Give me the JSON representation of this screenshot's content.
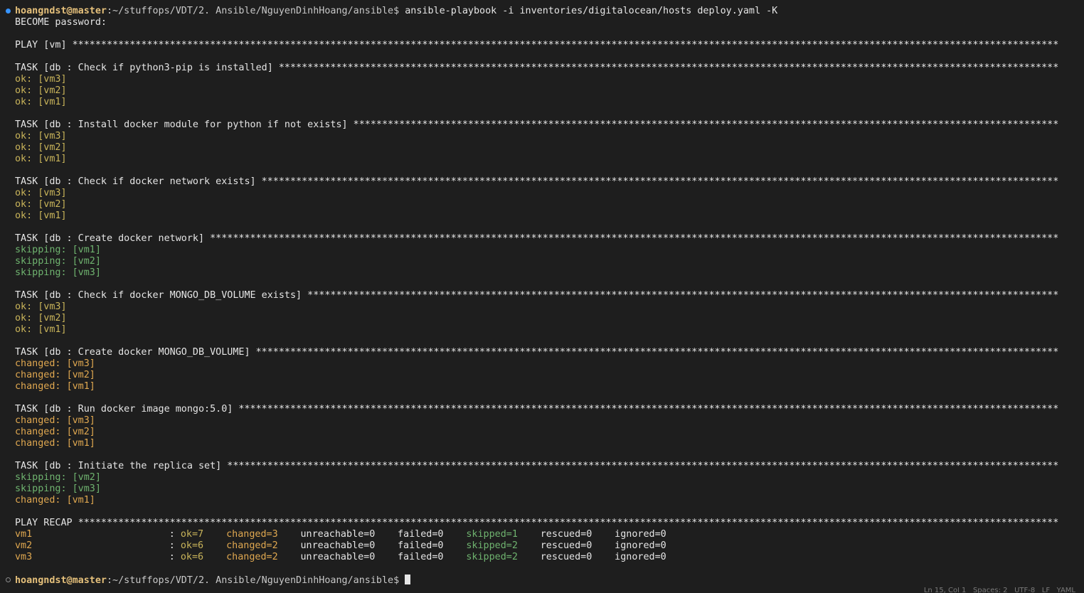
{
  "terminal": {
    "prompt_user": "hoangndst@master",
    "prompt_path": ":~/stuffops/VDT/2. Ansible/NguyenDinhHoang/ansible$",
    "command": " ansible-playbook -i inventories/digitalocean/hosts deploy.yaml -K",
    "become_prompt": "BECOME password:",
    "play_header": "PLAY [vm] ",
    "tasks": [
      {
        "title": "TASK [db : Check if python3-pip is installed] ",
        "results": [
          {
            "status": "ok:",
            "host": "[vm3]"
          },
          {
            "status": "ok:",
            "host": "[vm2]"
          },
          {
            "status": "ok:",
            "host": "[vm1]"
          }
        ]
      },
      {
        "title": "TASK [db : Install docker module for python if not exists] ",
        "results": [
          {
            "status": "ok:",
            "host": "[vm3]"
          },
          {
            "status": "ok:",
            "host": "[vm2]"
          },
          {
            "status": "ok:",
            "host": "[vm1]"
          }
        ]
      },
      {
        "title": "TASK [db : Check if docker network exists] ",
        "results": [
          {
            "status": "ok:",
            "host": "[vm3]"
          },
          {
            "status": "ok:",
            "host": "[vm2]"
          },
          {
            "status": "ok:",
            "host": "[vm1]"
          }
        ]
      },
      {
        "title": "TASK [db : Create docker network] ",
        "results": [
          {
            "status": "skipping:",
            "host": "[vm1]"
          },
          {
            "status": "skipping:",
            "host": "[vm2]"
          },
          {
            "status": "skipping:",
            "host": "[vm3]"
          }
        ]
      },
      {
        "title": "TASK [db : Check if docker MONGO_DB_VOLUME exists] ",
        "results": [
          {
            "status": "ok:",
            "host": "[vm3]"
          },
          {
            "status": "ok:",
            "host": "[vm2]"
          },
          {
            "status": "ok:",
            "host": "[vm1]"
          }
        ]
      },
      {
        "title": "TASK [db : Create docker MONGO_DB_VOLUME] ",
        "results": [
          {
            "status": "changed:",
            "host": "[vm3]"
          },
          {
            "status": "changed:",
            "host": "[vm2]"
          },
          {
            "status": "changed:",
            "host": "[vm1]"
          }
        ]
      },
      {
        "title": "TASK [db : Run docker image mongo:5.0] ",
        "results": [
          {
            "status": "changed:",
            "host": "[vm3]"
          },
          {
            "status": "changed:",
            "host": "[vm2]"
          },
          {
            "status": "changed:",
            "host": "[vm1]"
          }
        ]
      },
      {
        "title": "TASK [db : Initiate the replica set] ",
        "results": [
          {
            "status": "skipping:",
            "host": "[vm2]"
          },
          {
            "status": "skipping:",
            "host": "[vm3]"
          },
          {
            "status": "changed:",
            "host": "[vm1]"
          }
        ]
      }
    ],
    "recap_header": "PLAY RECAP ",
    "recap": [
      {
        "host": "vm1",
        "sep": ":",
        "ok": "ok=7",
        "changed": "changed=3",
        "unreachable": "unreachable=0",
        "failed": "failed=0",
        "skipped": "skipped=1",
        "rescued": "rescued=0",
        "ignored": "ignored=0"
      },
      {
        "host": "vm2",
        "sep": ":",
        "ok": "ok=6",
        "changed": "changed=2",
        "unreachable": "unreachable=0",
        "failed": "failed=0",
        "skipped": "skipped=2",
        "rescued": "rescued=0",
        "ignored": "ignored=0"
      },
      {
        "host": "vm3",
        "sep": ":",
        "ok": "ok=6",
        "changed": "changed=2",
        "unreachable": "unreachable=0",
        "failed": "failed=0",
        "skipped": "skipped=2",
        "rescued": "rescued=0",
        "ignored": "ignored=0"
      }
    ],
    "final_prompt_user": "hoangndst@master",
    "final_prompt_path": ":~/stuffops/VDT/2. Ansible/NguyenDinhHoang/ansible$",
    "status_bar": "Ln 15, Col 1   Spaces: 2   UTF-8   LF   YAML"
  },
  "colors": {
    "background": "#1e1e1e",
    "ok": "#c9b45a",
    "changed": "#e0a850",
    "skipping": "#6fb36f",
    "prompt_user": "#e5c07b",
    "decoration_active": "#3794ff"
  },
  "icons": {
    "command_decoration_success": "circle-filled-icon",
    "command_decoration_pending": "circle-hollow-icon"
  }
}
